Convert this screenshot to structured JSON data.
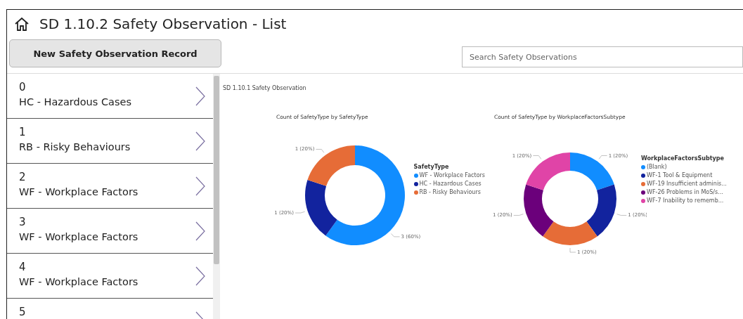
{
  "header": {
    "title": "SD 1.10.2 Safety Observation - List"
  },
  "toolbar": {
    "new_button": "New Safety Observation Record",
    "search": {
      "placeholder": "Search Safety Observations"
    }
  },
  "sidebar": {
    "items": [
      {
        "number": "0",
        "label": "HC - Hazardous Cases"
      },
      {
        "number": "1",
        "label": "RB - Risky Behaviours"
      },
      {
        "number": "2",
        "label": "WF - Workplace Factors"
      },
      {
        "number": "3",
        "label": "WF - Workplace Factors"
      },
      {
        "number": "4",
        "label": "WF - Workplace Factors"
      },
      {
        "number": "5"
      }
    ]
  },
  "report": {
    "title": "SD 1.10.1 Safety Observation",
    "charts": [
      {
        "legend": {
          "title": "SafetyType",
          "items": [
            {
              "label": "WF - Workplace Factors",
              "color": "#118dff"
            },
            {
              "label": "HC - Hazardous Cases",
              "color": "#12239e"
            },
            {
              "label": "RB - Risky Behaviours",
              "color": "#e66c37"
            }
          ]
        },
        "chart_data": {
          "type": "donut",
          "title": "Count of SafetyType by SafetyType",
          "series": [
            {
              "values": [
                60,
                20,
                20
              ]
            }
          ],
          "value_labels": [
            "3 (60%)",
            "1 (20%)",
            "1 (20%)"
          ]
        }
      },
      {
        "legend": {
          "title": "WorkplaceFactorsSubtype",
          "items": [
            {
              "label": "(Blank)",
              "color": "#118dff"
            },
            {
              "label": "WF-1 Tool & Equipment",
              "color": "#12239e"
            },
            {
              "label": "WF-19 Insufficient adminis...",
              "color": "#e66c37"
            },
            {
              "label": "WF-26 Problems in MoS/s...",
              "color": "#6b007b"
            },
            {
              "label": "WF-7 Inability to rememb...",
              "color": "#e044a7"
            }
          ]
        },
        "chart_data": {
          "type": "donut",
          "title": "Count of SafetyType by WorkplaceFactorsSubtype",
          "series": [
            {
              "values": [
                20,
                20,
                20,
                20,
                20
              ]
            }
          ],
          "value_labels": [
            "1 (20%)",
            "1 (20%)",
            "1 (20%)",
            "1 (20%)",
            "1 (20%)"
          ]
        }
      }
    ]
  }
}
